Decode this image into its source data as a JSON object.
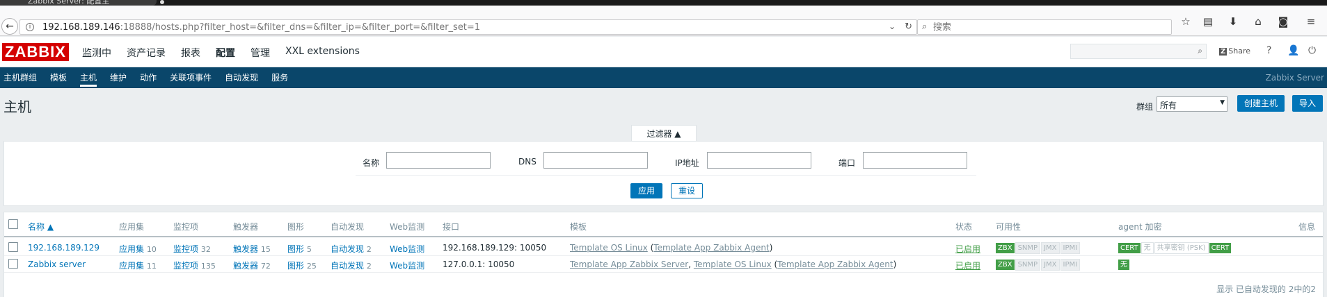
{
  "browser": {
    "tab_title": "Zabbix Server: 配置主",
    "url_host": "192.168.189.146",
    "url_rest": ":18888/hosts.php?filter_host=&filter_dns=&filter_ip=&filter_port=&filter_set=1",
    "search_placeholder": "搜索"
  },
  "header": {
    "logo": "ZABBIX",
    "menu": [
      "监测中",
      "资产记录",
      "报表",
      "配置",
      "管理",
      "XXL extensions"
    ],
    "active_menu": "配置",
    "share_label": "Share",
    "share_badge": "Z"
  },
  "submenu": {
    "items": [
      "主机群组",
      "模板",
      "主机",
      "维护",
      "动作",
      "关联项事件",
      "自动发现",
      "服务"
    ],
    "active": "主机",
    "server_name": "Zabbix Server"
  },
  "page": {
    "title": "主机",
    "group_label": "群组",
    "group_value": "所有",
    "create_button": "创建主机",
    "import_button": "导入"
  },
  "filter": {
    "tab_label": "过滤器 ▲",
    "fields": [
      {
        "label": "名称",
        "value": ""
      },
      {
        "label": "DNS",
        "value": ""
      },
      {
        "label": "IP地址",
        "value": ""
      },
      {
        "label": "端口",
        "value": ""
      }
    ],
    "apply_label": "应用",
    "reset_label": "重设"
  },
  "table": {
    "columns": [
      "名称 ▲",
      "应用集",
      "监控项",
      "触发器",
      "图形",
      "自动发现",
      "Web监测",
      "接口",
      "模板",
      "状态",
      "可用性",
      "agent 加密",
      "信息"
    ],
    "rows": [
      {
        "name": "192.168.189.129",
        "apps": "应用集",
        "apps_count": "10",
        "items": "监控项",
        "items_count": "32",
        "triggers": "触发器",
        "triggers_count": "15",
        "graphs": "图形",
        "graphs_count": "5",
        "discovery": "自动发现",
        "discovery_count": "2",
        "web": "Web监测",
        "interface": "192.168.189.129: 10050",
        "templates": [
          {
            "text": "Template OS Linux",
            "link": true
          },
          {
            "text": " (",
            "link": false
          },
          {
            "text": "Template App Zabbix Agent",
            "link": true
          },
          {
            "text": ")",
            "link": false
          }
        ],
        "status": "已启用",
        "availability": [
          {
            "text": "ZBX",
            "style": "green"
          },
          {
            "text": "SNMP",
            "style": "grey"
          },
          {
            "text": "JMX",
            "style": "grey"
          },
          {
            "text": "IPMI",
            "style": "grey"
          }
        ],
        "encryption": [
          {
            "text": "CERT",
            "style": "green"
          },
          {
            "text": "无",
            "style": "grey-plain"
          },
          {
            "text": "共享密钥 (PSK)",
            "style": "grey-plain"
          },
          {
            "text": "CERT",
            "style": "green"
          }
        ]
      },
      {
        "name": "Zabbix server",
        "apps": "应用集",
        "apps_count": "11",
        "items": "监控项",
        "items_count": "135",
        "triggers": "触发器",
        "triggers_count": "72",
        "graphs": "图形",
        "graphs_count": "25",
        "discovery": "自动发现",
        "discovery_count": "2",
        "web": "Web监测",
        "interface": "127.0.0.1: 10050",
        "templates": [
          {
            "text": "Template App Zabbix Server",
            "link": true
          },
          {
            "text": ", ",
            "link": false
          },
          {
            "text": "Template OS Linux",
            "link": true
          },
          {
            "text": " (",
            "link": false
          },
          {
            "text": "Template App Zabbix Agent",
            "link": true
          },
          {
            "text": ")",
            "link": false
          }
        ],
        "status": "已启用",
        "availability": [
          {
            "text": "ZBX",
            "style": "green"
          },
          {
            "text": "SNMP",
            "style": "grey"
          },
          {
            "text": "JMX",
            "style": "grey"
          },
          {
            "text": "IPMI",
            "style": "grey"
          }
        ],
        "encryption": [
          {
            "text": "无",
            "style": "green"
          }
        ]
      }
    ],
    "footer": "显示 已自动发现的 2中的2"
  },
  "colors": {
    "brand": "#d40000",
    "accent": "#0275b8",
    "subnav": "#0a466a",
    "enabled": "#429e47"
  }
}
